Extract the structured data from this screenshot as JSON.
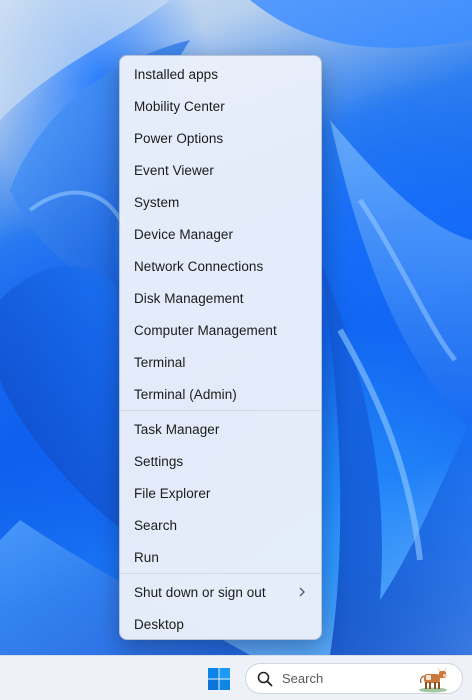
{
  "menu": {
    "items": [
      {
        "label": "Installed apps"
      },
      {
        "label": "Mobility Center"
      },
      {
        "label": "Power Options"
      },
      {
        "label": "Event Viewer"
      },
      {
        "label": "System"
      },
      {
        "label": "Device Manager"
      },
      {
        "label": "Network Connections"
      },
      {
        "label": "Disk Management"
      },
      {
        "label": "Computer Management"
      },
      {
        "label": "Terminal"
      },
      {
        "label": "Terminal (Admin)"
      },
      {
        "label": "Task Manager"
      },
      {
        "label": "Settings"
      },
      {
        "label": "File Explorer"
      },
      {
        "label": "Search"
      },
      {
        "label": "Run"
      },
      {
        "label": "Shut down or sign out",
        "has_submenu": true
      },
      {
        "label": "Desktop"
      }
    ]
  },
  "taskbar": {
    "search_placeholder": "Search",
    "start_icon": "windows-logo-icon",
    "search_icon": "search-icon"
  },
  "colors": {
    "menu_background": "#ECF0FA",
    "menu_text": "#1B1B1B",
    "taskbar_background": "#EEF1F7",
    "wallpaper_blue": "#0F5FE8",
    "windows_logo": "#0078D4"
  }
}
